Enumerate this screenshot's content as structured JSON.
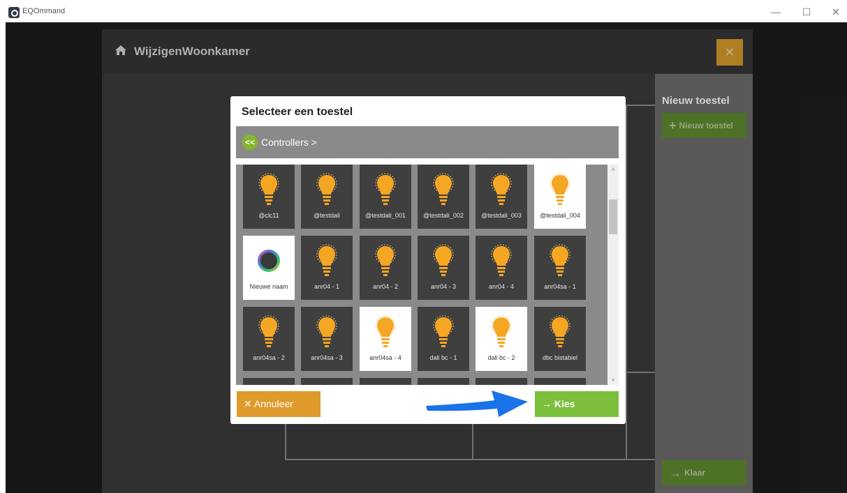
{
  "window": {
    "title": "EQOmmand",
    "minimize": "—",
    "maximize": "☐",
    "close": "✕"
  },
  "panel": {
    "title": "WijzigenWoonkamer",
    "close_icon": "✕"
  },
  "sidebar": {
    "title": "Nieuw toestel",
    "new_button": "Nieuw toestel",
    "done_button": "Klaar"
  },
  "dialog": {
    "title": "Selecteer een toestel",
    "breadcrumb": "Controllers >",
    "back_icon": "<<",
    "cancel_label": "Annuleer",
    "choose_label": "Kies",
    "devices": [
      {
        "label": "@clc11",
        "icon": "bulb-icon",
        "selected": false
      },
      {
        "label": "@testdali",
        "icon": "bulb-icon",
        "selected": false
      },
      {
        "label": "@testdali_001",
        "icon": "bulb-icon",
        "selected": false
      },
      {
        "label": "@testdali_002",
        "icon": "bulb-icon",
        "selected": false
      },
      {
        "label": "@testdali_003",
        "icon": "bulb-icon",
        "selected": false
      },
      {
        "label": "@testdali_004",
        "icon": "bulb-icon",
        "selected": true
      },
      {
        "label": "Nieuwe naam",
        "icon": "rgb-ring-icon",
        "selected": true
      },
      {
        "label": "anr04 - 1",
        "icon": "bulb-icon",
        "selected": false
      },
      {
        "label": "anr04 - 2",
        "icon": "bulb-icon",
        "selected": false
      },
      {
        "label": "anr04 - 3",
        "icon": "bulb-icon",
        "selected": false
      },
      {
        "label": "anr04 - 4",
        "icon": "bulb-icon",
        "selected": false
      },
      {
        "label": "anr04sa - 1",
        "icon": "bulb-icon",
        "selected": false
      },
      {
        "label": "anr04sa - 2",
        "icon": "bulb-icon",
        "selected": false
      },
      {
        "label": "anr04sa - 3",
        "icon": "bulb-icon",
        "selected": false
      },
      {
        "label": "anr04sa - 4",
        "icon": "bulb-icon",
        "selected": true
      },
      {
        "label": "dali bc - 1",
        "icon": "bulb-icon",
        "selected": false
      },
      {
        "label": "dali bc - 2",
        "icon": "bulb-icon",
        "selected": true
      },
      {
        "label": "dbc bistabiel",
        "icon": "bulb-icon",
        "selected": false
      }
    ]
  },
  "colors": {
    "accent_orange": "#df9a2c",
    "accent_green": "#7cbf3c",
    "bulb": "#f5a623",
    "arrow_blue": "#1a73e8"
  }
}
